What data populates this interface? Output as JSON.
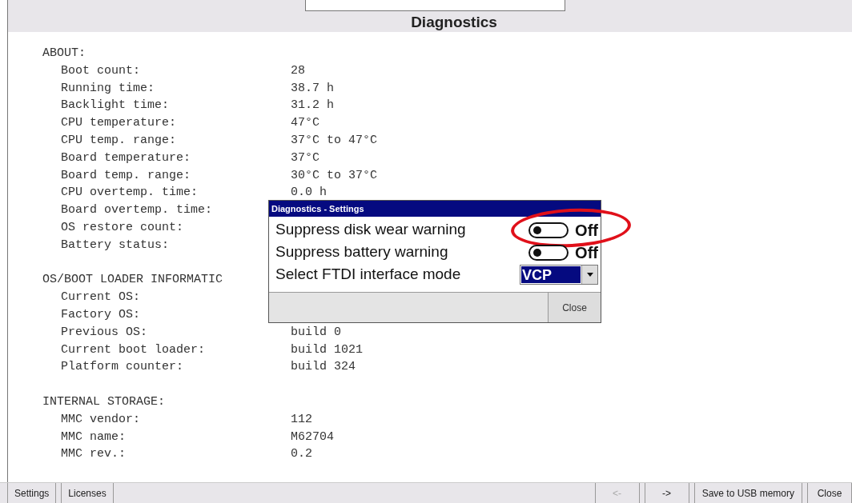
{
  "window": {
    "title": "Diagnostics"
  },
  "sections": [
    {
      "heading": "ABOUT:",
      "rows": [
        {
          "label": "Boot count:",
          "value": "28"
        },
        {
          "label": "Running time:",
          "value": "38.7 h"
        },
        {
          "label": "Backlight time:",
          "value": "31.2 h"
        },
        {
          "label": "CPU temperature:",
          "value": "47°C"
        },
        {
          "label": "CPU temp. range:",
          "value": "37°C to 47°C"
        },
        {
          "label": "Board temperature:",
          "value": "37°C"
        },
        {
          "label": "Board temp. range:",
          "value": "30°C to 37°C"
        },
        {
          "label": "CPU overtemp. time:",
          "value": "0.0 h"
        },
        {
          "label": "Board overtemp. time:"
        },
        {
          "label": "OS restore count:"
        },
        {
          "label": "Battery status:"
        }
      ]
    },
    {
      "heading": "OS/BOOT LOADER INFORMATIC",
      "rows": [
        {
          "label": "Current OS:"
        },
        {
          "label": "Factory OS:"
        },
        {
          "label": "Previous OS:",
          "value": "build 0"
        },
        {
          "label": "Current boot loader:",
          "value": "build 1021"
        },
        {
          "label": "Platform counter:",
          "value": "build 324"
        }
      ]
    },
    {
      "heading": "INTERNAL STORAGE:",
      "rows": [
        {
          "label": "MMC vendor:",
          "value": "112"
        },
        {
          "label": "MMC name:",
          "value": "M62704"
        },
        {
          "label": "MMC rev.:",
          "value": "0.2"
        }
      ]
    }
  ],
  "dialog": {
    "title": "Diagnostics - Settings",
    "settings": [
      {
        "kind": "toggle",
        "label": "Suppress disk wear warning",
        "on": false,
        "state_text": "Off",
        "highlighted": true
      },
      {
        "kind": "toggle",
        "label": "Suppress battery warning",
        "on": false,
        "state_text": "Off",
        "highlighted": false
      },
      {
        "kind": "dropdown",
        "label": "Select FTDI interface mode",
        "value": "VCP"
      }
    ],
    "buttons": [
      "Close"
    ]
  },
  "bottom_bar": {
    "left_buttons": [
      {
        "label": "Settings",
        "disabled": false
      },
      {
        "label": "Licenses",
        "disabled": false
      }
    ],
    "right_buttons": [
      {
        "label": "<-",
        "disabled": true
      },
      {
        "label": "->",
        "disabled": false
      },
      {
        "label": "Save to USB memory",
        "disabled": false
      },
      {
        "label": "Close",
        "disabled": false
      }
    ]
  }
}
